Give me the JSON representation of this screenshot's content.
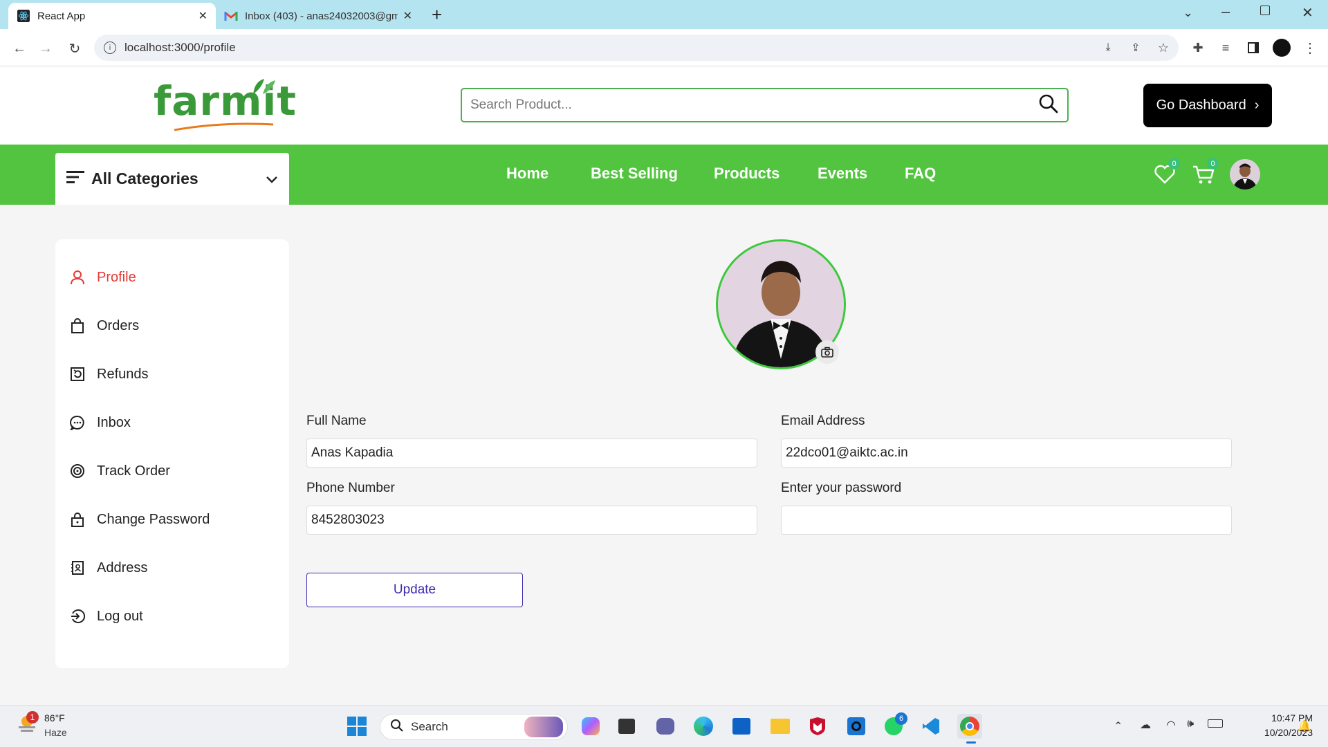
{
  "browser": {
    "tabs": [
      {
        "title": "React App",
        "active": true
      },
      {
        "title": "Inbox (403) - anas24032003@gm",
        "active": false
      }
    ],
    "url": "localhost:3000/profile"
  },
  "header": {
    "logo": "farmit",
    "search_placeholder": "Search Product...",
    "dashboard_button": "Go Dashboard"
  },
  "nav": {
    "categories_label": "All Categories",
    "links": [
      "Home",
      "Best Selling",
      "Products",
      "Events",
      "FAQ"
    ],
    "wishlist_count": "0",
    "cart_count": "0"
  },
  "sidebar": {
    "items": [
      {
        "label": "Profile",
        "icon": "user-icon",
        "active": true
      },
      {
        "label": "Orders",
        "icon": "bag-icon"
      },
      {
        "label": "Refunds",
        "icon": "refund-icon"
      },
      {
        "label": "Inbox",
        "icon": "chat-icon"
      },
      {
        "label": "Track Order",
        "icon": "track-icon"
      },
      {
        "label": "Change Password",
        "icon": "lock-icon"
      },
      {
        "label": "Address",
        "icon": "address-book-icon"
      },
      {
        "label": "Log out",
        "icon": "logout-icon"
      }
    ]
  },
  "profile": {
    "full_name_label": "Full Name",
    "full_name": "Anas Kapadia",
    "email_label": "Email Address",
    "email": "22dco01@aiktc.ac.in",
    "phone_label": "Phone Number",
    "phone": "8452803023",
    "password_label": "Enter your password",
    "password": "",
    "update_button": "Update"
  },
  "taskbar": {
    "weather_temp": "86°F",
    "weather_desc": "Haze",
    "weather_badge": "1",
    "search_label": "Search",
    "whatsapp_badge": "6",
    "time": "10:47 PM",
    "date": "10/20/2023"
  },
  "colors": {
    "brand_green": "#52c43f",
    "active_red": "#e53935",
    "update_purple": "#3c2bb0"
  }
}
